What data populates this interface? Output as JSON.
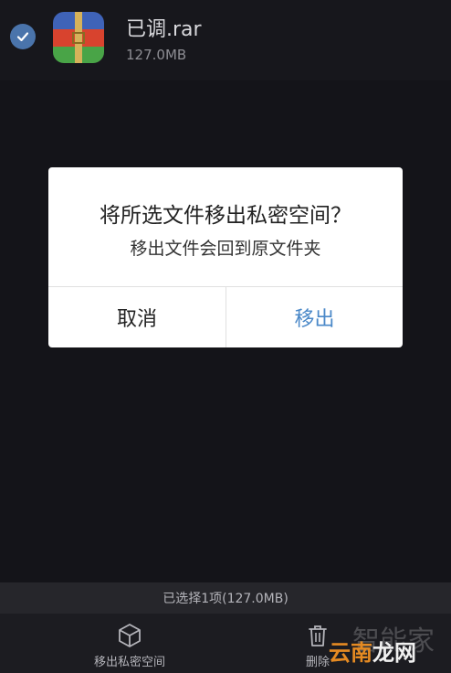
{
  "file": {
    "name": "已调.rar",
    "size": "127.0MB",
    "selected": true,
    "icon": "rar-archive-icon"
  },
  "dialog": {
    "title": "将所选文件移出私密空间？",
    "message": "移出文件会回到原文件夹",
    "cancel_label": "取消",
    "confirm_label": "移出"
  },
  "status": {
    "selection_text": "已选择1项(127.0MB)"
  },
  "toolbar": {
    "move_label": "移出私密空间",
    "move_icon": "cube-icon",
    "delete_label": "删除",
    "delete_icon": "trash-icon"
  },
  "watermark": {
    "back_text": "智能家",
    "front_part1": "云南",
    "front_part2": "龙网"
  },
  "colors": {
    "accent": "#4a88c8",
    "check": "#4a74ab",
    "background": "#141419",
    "dialog_bg": "#ffffff",
    "watermark_orange": "#e58a22"
  }
}
